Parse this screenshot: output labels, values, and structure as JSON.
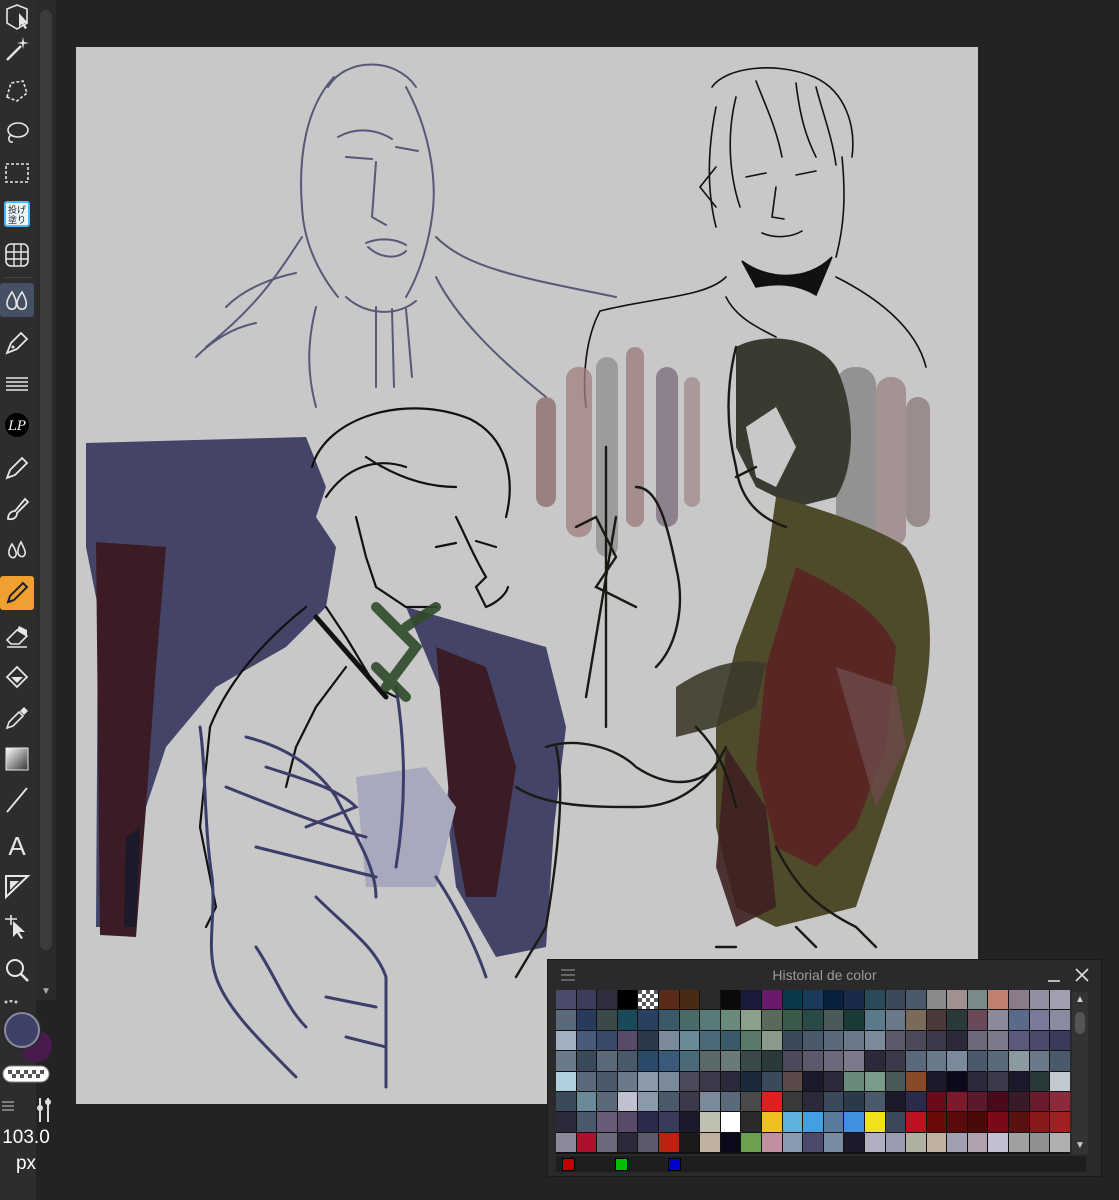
{
  "tools": [
    {
      "name": "move-tool-icon"
    },
    {
      "name": "magic-wand-icon"
    },
    {
      "name": "polyline-select-icon"
    },
    {
      "name": "lasso-select-icon"
    },
    {
      "name": "rect-select-icon"
    },
    {
      "name": "fill-plugin-icon"
    },
    {
      "name": "grid-ruler-icon"
    },
    {
      "name": "blend-tool-icon"
    },
    {
      "name": "pen-icon"
    },
    {
      "name": "lines-icon"
    },
    {
      "name": "lp-plugin-icon"
    },
    {
      "name": "pencil-icon"
    },
    {
      "name": "brush-icon"
    },
    {
      "name": "water-drop-icon"
    },
    {
      "name": "marker-icon"
    },
    {
      "name": "eraser-icon"
    },
    {
      "name": "fill-bucket-icon"
    },
    {
      "name": "eyedropper-icon"
    },
    {
      "name": "gradient-icon"
    },
    {
      "name": "line-icon"
    },
    {
      "name": "text-icon"
    },
    {
      "name": "frame-icon"
    },
    {
      "name": "operation-icon"
    },
    {
      "name": "zoom-icon"
    }
  ],
  "brush_size": {
    "value": "103.0",
    "unit": "px"
  },
  "colors": {
    "main": "#3f4068",
    "sub": "#4a1a4e"
  },
  "history": {
    "title": "Historial de color",
    "swatches": [
      "#4a4a6a",
      "#3d3d5c",
      "#2e2e3e",
      "#000000",
      "#ffffff",
      "#5a2a1a",
      "#4a2a10",
      "#2a2a2a",
      "#0a0a0a",
      "#1a1a3a",
      "#6a1a6a",
      "#0a3a4a",
      "#1a3a5a",
      "#0a2040",
      "#1a2a4a",
      "#2a4a5a",
      "#3a4a5a",
      "#4a5a6a",
      "#8a8a8a",
      "#a09090",
      "#7a8a8a",
      "#c08070",
      "#8a7a8a",
      "#9090a0",
      "#a0a0b0",
      "#5a6a7a",
      "#2a3a5a",
      "#3a4a4a",
      "#1a4a5a",
      "#2a4060",
      "#3a5a6a",
      "#4a6a6a",
      "#5a7a7a",
      "#6a8a7a",
      "#8aa08a",
      "#5a6a5a",
      "#3a5a4a",
      "#2a4a4a",
      "#4a5a5a",
      "#1a3a3a",
      "#5a7a8a",
      "#6a7a8a",
      "#7a6a5a",
      "#4a3a3a",
      "#2a3a3a",
      "#6a4a5a",
      "#8a8a9a",
      "#5a6a8a",
      "#7a7a9a",
      "#8a8aa0",
      "#a0b0c0",
      "#4a5a7a",
      "#3a4a6a",
      "#5a4a6a",
      "#2a3a4a",
      "#7a8a9a",
      "#6a8a9a",
      "#4a6a7a",
      "#3a5a6a",
      "#5a7a6a",
      "#8a9a8a",
      "#3a4a5a",
      "#4a5a6a",
      "#5a6a7a",
      "#6a7a8a",
      "#7a8a9a",
      "#5a5a6a",
      "#4a4a5a",
      "#3a3a4a",
      "#2a2a3a",
      "#6a6a7a",
      "#7a7a8a",
      "#5a5a7a",
      "#4a4a6a",
      "#3a3a5a",
      "#6a7a8a",
      "#3a4a5a",
      "#5a6a7a",
      "#4a5a6a",
      "#2a4a6a",
      "#3a5a7a",
      "#4a6a7a",
      "#5a6a6a",
      "#6a7a7a",
      "#3a4a4a",
      "#2a3a3a",
      "#4a4a5a",
      "#5a5a6a",
      "#6a6a7a",
      "#7a7a8a",
      "#2a2a3a",
      "#3a3a4a",
      "#5a6a7a",
      "#6a7a8a",
      "#7a8a9a",
      "#4a5a6a",
      "#5a6a7a",
      "#8a9aa0",
      "#6a7a8a",
      "#4a5a6a",
      "#b0d0e0",
      "#5a6a7a",
      "#4a5a6a",
      "#6a7a8a",
      "#8a9aaa",
      "#7a8a9a",
      "#4a4a5a",
      "#3a3a4a",
      "#2a2a3a",
      "#1a2a3a",
      "#3a4a5a",
      "#5a4a4a",
      "#1a1a2a",
      "#2a2a3a",
      "#6a8a7a",
      "#7a9a8a",
      "#4a5a5a",
      "#8a4a2a",
      "#1a1a2a",
      "#0a0a1a",
      "#2a2a3a",
      "#3a3a4a",
      "#1a1a2a",
      "#2a3a3a",
      "#c0c8d0",
      "#3a4a5a",
      "#6a8a9a",
      "#5a6a7a",
      "#c0c0d0",
      "#8a9aaa",
      "#4a5a6a",
      "#3a3a4a",
      "#7a8a9a",
      "#5a6a7a",
      "#4a4a4a",
      "#e02020",
      "#3a3a3a",
      "#2a2a3a",
      "#3a4a5a",
      "#2a3a4a",
      "#4a5a6a",
      "#1a1a2a",
      "#2a2a4a",
      "#6a0a1a",
      "#7a1a2a",
      "#5a1a2a",
      "#4a0a1a",
      "#3a1a2a",
      "#6a1a2a",
      "#8a2a3a",
      "#2a2a3a",
      "#4a5a6a",
      "#6a5a7a",
      "#5a4a6a",
      "#2a2a4a",
      "#3a3a5a",
      "#1a1a2a",
      "#c0c0b0",
      "#ffffff",
      "#2a2a2a",
      "#f0c020",
      "#60b0e0",
      "#40a0e0",
      "#5a7aa0",
      "#4090e0",
      "#f0e020",
      "#3a4a5a",
      "#c01020",
      "#6a0a0a",
      "#5a0a0a",
      "#4a0a0a",
      "#7a0a1a",
      "#5a1010",
      "#8a1a1a",
      "#a02020",
      "#8a8a9a",
      "#b01030",
      "#6a6a7a",
      "#2a2a3a",
      "#5a5a6a",
      "#c02010",
      "#1a1a1a",
      "#c0b0a0",
      "#0a0a1a",
      "#6aa050",
      "#c090a0",
      "#8a9ab0",
      "#4a4a6a",
      "#7a8aa0",
      "#1a1a2a",
      "#b0b0c0",
      "#9a9ab0",
      "#b0b0a0",
      "#c0b0a0",
      "#a0a0b0",
      "#b0a0b0",
      "#c0c0d0",
      "#a0a0a0",
      "#909090",
      "#b0b0b0"
    ],
    "rgb": [
      "#c00000",
      "#00c000",
      "#0000d0"
    ]
  }
}
